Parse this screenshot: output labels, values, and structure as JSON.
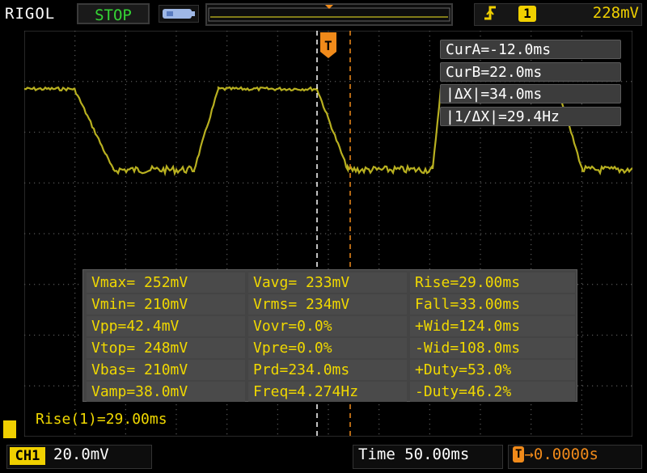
{
  "header": {
    "brand": "RIGOL",
    "run_state": "STOP",
    "trigger": {
      "icon": "rising-edge-icon",
      "channel": "1",
      "level": "228mV",
      "color": "#f0d000"
    }
  },
  "cursors": {
    "cur_a": "CurA=-12.0ms",
    "cur_b": "CurB=22.0ms",
    "delta_x": "|ΔX|=34.0ms",
    "inv_delta_x": "|1/ΔX|=29.4Hz",
    "cursor_a_time_ms": -12.0,
    "cursor_b_time_ms": 22.0
  },
  "measurements": {
    "rows": [
      [
        "Vmax= 252mV",
        "Vavg= 233mV",
        "Rise=29.00ms"
      ],
      [
        "Vmin= 210mV",
        "Vrms= 234mV",
        "Fall=33.00ms"
      ],
      [
        "Vpp=42.4mV",
        "Vovr=0.0%",
        "+Wid=124.0ms"
      ],
      [
        "Vtop= 248mV",
        "Vpre=0.0%",
        "-Wid=108.0ms"
      ],
      [
        "Vbas= 210mV",
        "Prd=234.0ms",
        "+Duty=53.0%"
      ],
      [
        "Vamp=38.0mV",
        "Freq=4.274Hz",
        "-Duty=46.2%"
      ]
    ]
  },
  "status": {
    "rise_readout": "Rise(1)=29.00ms"
  },
  "footer": {
    "channel_badge": "CH1",
    "volts_per_div": "20.0mV",
    "timebase": "Time 50.00ms",
    "trigger_offset": "0.0000s"
  },
  "colors": {
    "trace": "#b8b020",
    "cursor_a": "#ffffff",
    "cursor_b": "#f08a1a",
    "readout_yellow": "#f0d800"
  }
}
